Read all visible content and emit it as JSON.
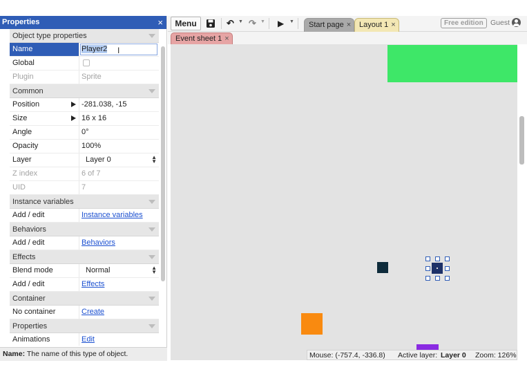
{
  "properties_panel": {
    "title": "Properties",
    "close_glyph": "×",
    "sections": {
      "object_type": "Object type properties",
      "common": "Common",
      "instance_vars": "Instance variables",
      "behaviors": "Behaviors",
      "effects": "Effects",
      "container": "Container",
      "properties": "Properties"
    },
    "rows": {
      "name": {
        "label": "Name",
        "value": "Player2"
      },
      "global": {
        "label": "Global"
      },
      "plugin": {
        "label": "Plugin",
        "value": "Sprite"
      },
      "position": {
        "label": "Position",
        "value": "-281.038, -15"
      },
      "size": {
        "label": "Size",
        "value": "16 x 16"
      },
      "angle": {
        "label": "Angle",
        "value": "0°"
      },
      "opacity": {
        "label": "Opacity",
        "value": "100%"
      },
      "layer": {
        "label": "Layer",
        "value": "Layer 0"
      },
      "z_index": {
        "label": "Z index",
        "value": "6 of 7"
      },
      "uid": {
        "label": "UID",
        "value": "7"
      },
      "instance_vars": {
        "label": "Add / edit",
        "link": "Instance variables"
      },
      "behaviors": {
        "label": "Add / edit",
        "link": "Behaviors"
      },
      "blend_mode": {
        "label": "Blend mode",
        "value": "Normal"
      },
      "effects": {
        "label": "Add / edit",
        "link": "Effects"
      },
      "container": {
        "label": "No container",
        "link": "Create"
      },
      "animations": {
        "label": "Animations",
        "link": "Edit"
      }
    },
    "footer": {
      "bold": "Name:",
      "text": " The name of this type of object."
    }
  },
  "toolbar": {
    "menu_label": "Menu",
    "tabs": {
      "start_page": "Start page",
      "layout": "Layout 1",
      "event_sheet": "Event sheet 1"
    },
    "tab_close": "×",
    "edition_badge": "Free edition",
    "user_label": "Guest"
  },
  "status": {
    "mouse": "Mouse: (-757.4, -336.8)",
    "active_layer_prefix": "Active layer:",
    "active_layer_value": "Layer 0",
    "zoom": "Zoom: 126%"
  },
  "colors": {
    "accent": "#2f5db6",
    "green_object": "#3ee768",
    "orange_object": "#f98a10",
    "purple_object": "#8a2be2",
    "layout_tab": "#f3e7b4",
    "event_tab": "#e6a4a4"
  }
}
